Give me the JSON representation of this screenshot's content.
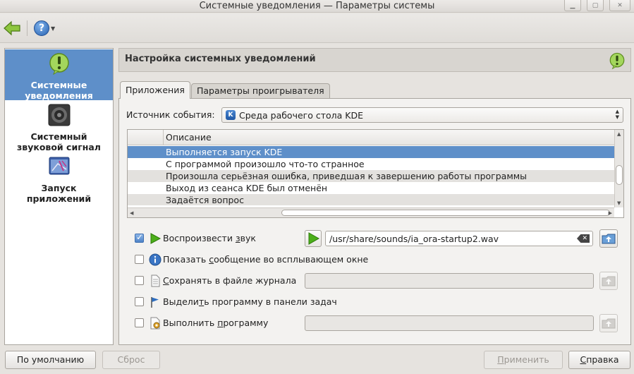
{
  "window": {
    "title": "Системные уведомления — Параметры системы"
  },
  "sidebar": {
    "items": [
      {
        "label": "Системные уведомления",
        "icon": "notification-icon",
        "active": true
      },
      {
        "label": "Системный звуковой сигнал",
        "icon": "speaker-icon",
        "active": false
      },
      {
        "label": "Запуск приложений",
        "icon": "launch-feedback-icon",
        "active": false
      }
    ]
  },
  "panel": {
    "title": "Настройка системных уведомлений"
  },
  "tabs": [
    {
      "label": "Приложения",
      "active": true
    },
    {
      "label": "Параметры проигрывателя",
      "active": false
    }
  ],
  "event_source": {
    "label": "Источник события:",
    "value": "Среда рабочего стола KDE",
    "icon_text": "K"
  },
  "events_table": {
    "column_header": "Описание",
    "rows": [
      {
        "text": "Выполняется запуск KDE",
        "selected": true
      },
      {
        "text": "С программой произошло что-то странное",
        "selected": false
      },
      {
        "text": "Произошла серьёзная ошибка, приведшая к завершению работы программы",
        "selected": false
      },
      {
        "text": "Выход из сеанса KDE был отменён",
        "selected": false
      },
      {
        "text": "Задаётся вопрос",
        "selected": false
      }
    ]
  },
  "options": {
    "play_sound": {
      "pre": "Воспроизвести ",
      "u": "з",
      "post": "вук",
      "checked": true,
      "path": "/usr/share/sounds/ia_ora-startup2.wav"
    },
    "popup": {
      "pre": "Показать ",
      "u": "с",
      "post": "ообщение во всплывающем окне",
      "checked": false
    },
    "log_file": {
      "pre": "",
      "u": "С",
      "post": "охранять в файле журнала",
      "checked": false,
      "path": ""
    },
    "taskbar": {
      "pre": "Выдели",
      "u": "т",
      "post": "ь программу в панели задач",
      "checked": false
    },
    "run_program": {
      "pre": "Выполнить ",
      "u": "п",
      "post": "рограмму",
      "checked": false,
      "path": ""
    }
  },
  "buttons": {
    "defaults": "По умолчанию",
    "reset": "Сброс",
    "apply_u": "П",
    "apply_rest": "рименить",
    "help_u": "С",
    "help_rest": "правка"
  },
  "colors": {
    "selection": "#5e8fc9",
    "play_green": "#4caf1a"
  }
}
